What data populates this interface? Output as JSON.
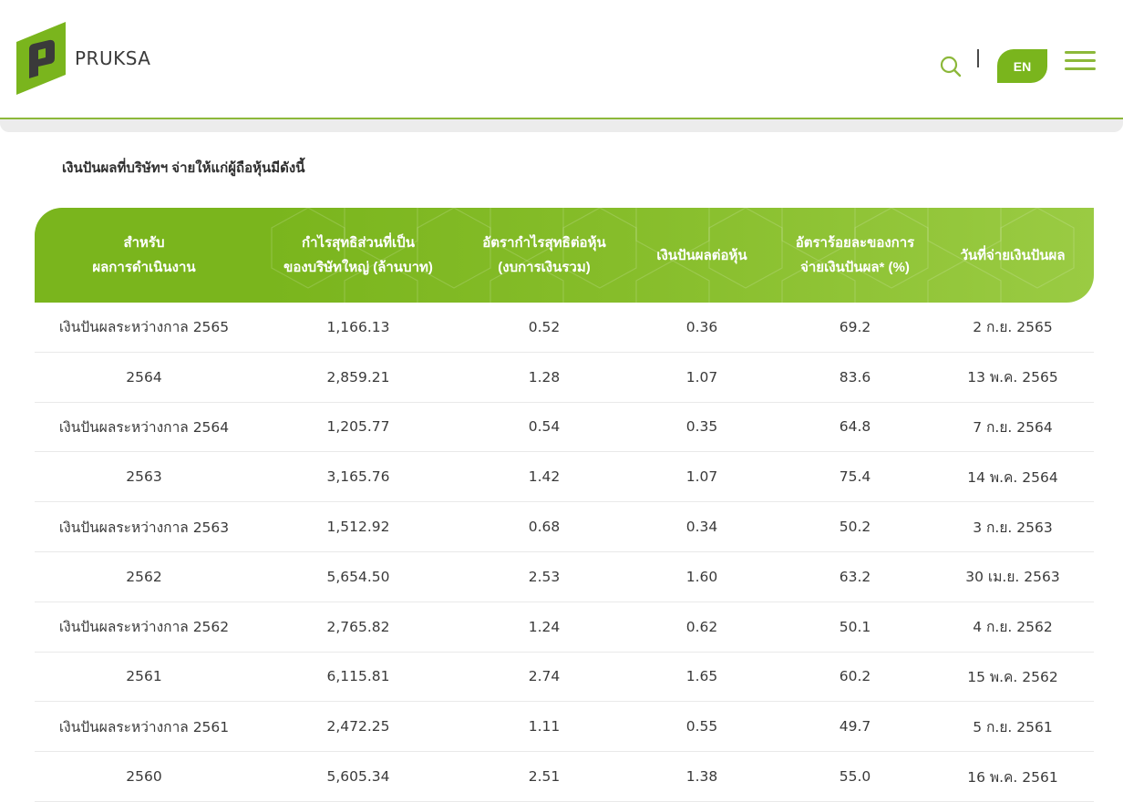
{
  "header": {
    "brand": "PRUKSA",
    "language_button": "EN",
    "colors": {
      "accent": "#7ab51d",
      "accent_light": "#9acb43",
      "text": "#3a3a3a"
    },
    "icons": {
      "search": "search-icon",
      "menu": "hamburger-menu-icon",
      "logo": "pruksa-logo-icon"
    }
  },
  "content": {
    "intro": "เงินปันผลที่บริษัทฯ จ่ายให้แก่ผู้ถือหุ้นมีดังนี้"
  },
  "table": {
    "headers": [
      "สำหรับ\nผลการดำเนินงาน",
      "กำไรสุทธิส่วนที่เป็น\nของบริษัทใหญ่ (ล้านบาท)",
      "อัตรากำไรสุทธิต่อหุ้น\n(งบการเงินรวม)",
      "เงินปันผลต่อหุ้น",
      "อัตราร้อยละของการ\nจ่ายเงินปันผล* (%)",
      "วันที่จ่ายเงินปันผล"
    ],
    "rows": [
      [
        "เงินปันผลระหว่างกาล 2565",
        "1,166.13",
        "0.52",
        "0.36",
        "69.2",
        "2 ก.ย. 2565"
      ],
      [
        "2564",
        "2,859.21",
        "1.28",
        "1.07",
        "83.6",
        "13 พ.ค. 2565"
      ],
      [
        "เงินปันผลระหว่างกาล 2564",
        "1,205.77",
        "0.54",
        "0.35",
        "64.8",
        "7 ก.ย. 2564"
      ],
      [
        "2563",
        "3,165.76",
        "1.42",
        "1.07",
        "75.4",
        "14 พ.ค. 2564"
      ],
      [
        "เงินปันผลระหว่างกาล 2563",
        "1,512.92",
        "0.68",
        "0.34",
        "50.2",
        "3 ก.ย. 2563"
      ],
      [
        "2562",
        "5,654.50",
        "2.53",
        "1.60",
        "63.2",
        "30 เม.ย. 2563"
      ],
      [
        "เงินปันผลระหว่างกาล 2562",
        "2,765.82",
        "1.24",
        "0.62",
        "50.1",
        "4 ก.ย. 2562"
      ],
      [
        "2561",
        "6,115.81",
        "2.74",
        "1.65",
        "60.2",
        "15 พ.ค. 2562"
      ],
      [
        "เงินปันผลระหว่างกาล 2561",
        "2,472.25",
        "1.11",
        "0.55",
        "49.7",
        "5 ก.ย. 2561"
      ],
      [
        "2560",
        "5,605.34",
        "2.51",
        "1.38",
        "55.0",
        "16 พ.ค. 2561"
      ]
    ]
  }
}
